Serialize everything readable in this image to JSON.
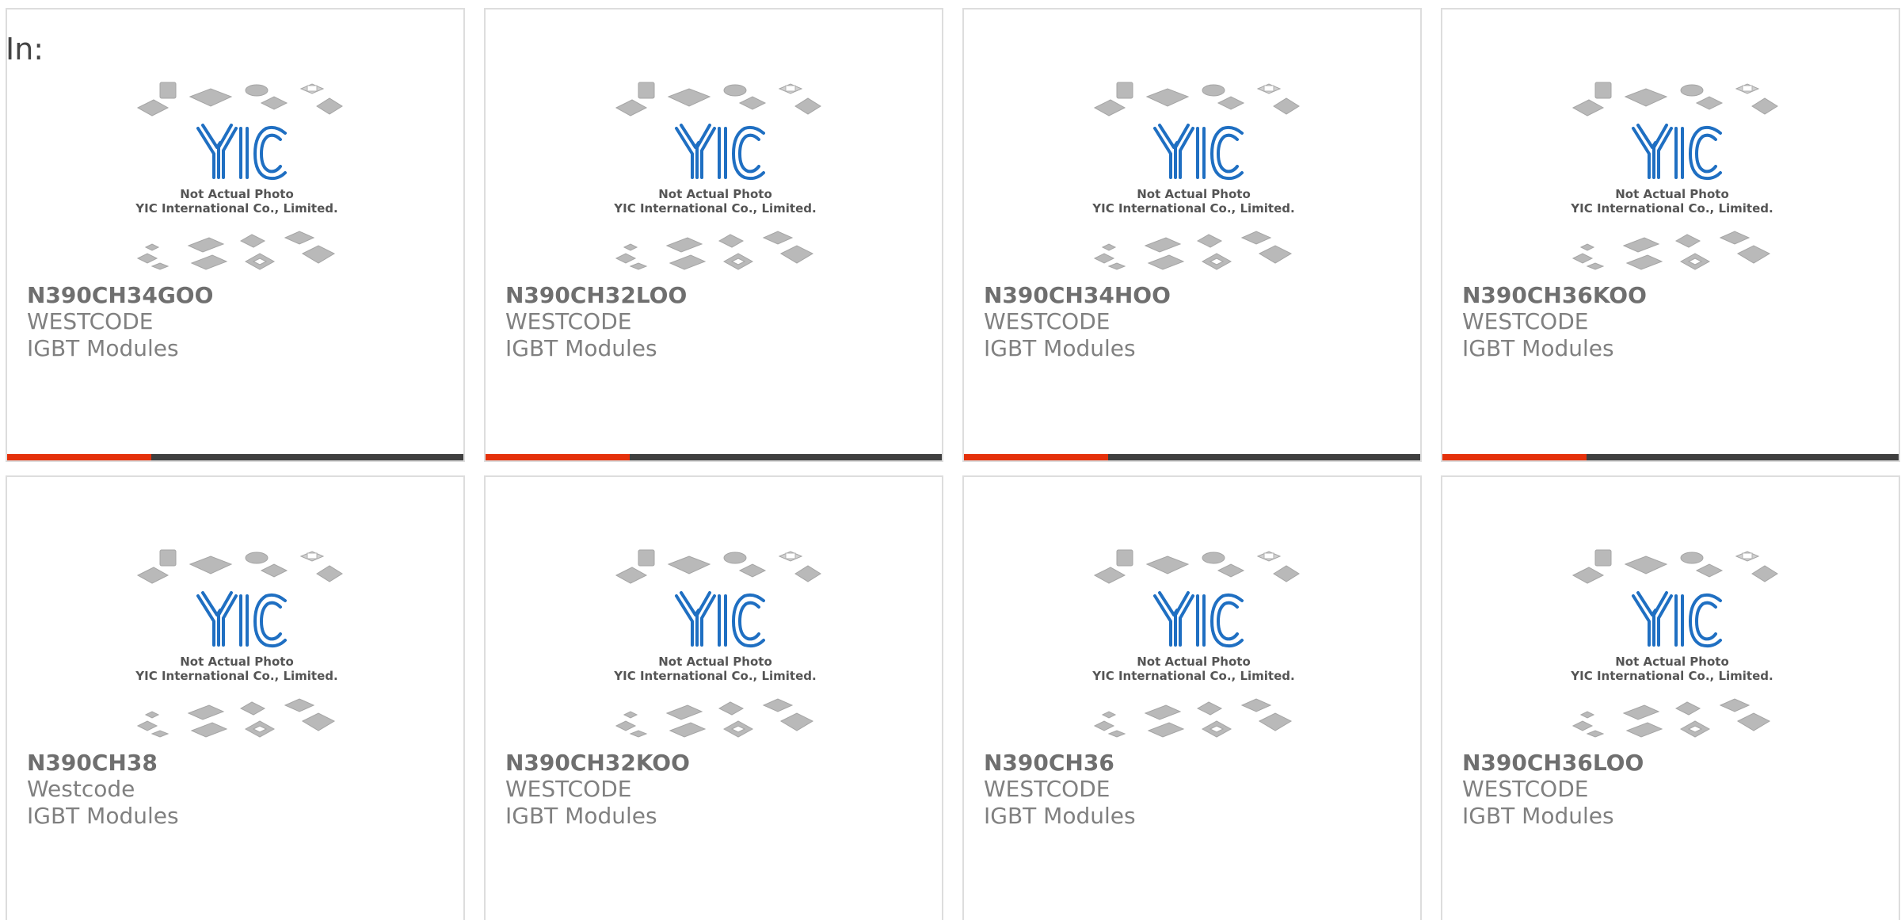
{
  "page": {
    "heading": "In:"
  },
  "colors": {
    "accent_bar": "#e5310b",
    "dark_bar": "#3f3f3f",
    "logo_blue": "#1f6fc2",
    "chip_gray": "#b4b4b4"
  },
  "photo": {
    "line1": "Not Actual Photo",
    "line2": "YIC International Co., Limited.",
    "logo_text": "YIC"
  },
  "products": [
    {
      "part_number": "N390CH34GOO",
      "manufacturer": "WESTCODE",
      "category": "IGBT Modules"
    },
    {
      "part_number": "N390CH32LOO",
      "manufacturer": "WESTCODE",
      "category": "IGBT Modules"
    },
    {
      "part_number": "N390CH34HOO",
      "manufacturer": "WESTCODE",
      "category": "IGBT Modules"
    },
    {
      "part_number": "N390CH36KOO",
      "manufacturer": "WESTCODE",
      "category": "IGBT Modules"
    },
    {
      "part_number": "N390CH38",
      "manufacturer": "Westcode",
      "category": "IGBT Modules"
    },
    {
      "part_number": "N390CH32KOO",
      "manufacturer": "WESTCODE",
      "category": "IGBT Modules"
    },
    {
      "part_number": "N390CH36",
      "manufacturer": "WESTCODE",
      "category": "IGBT Modules"
    },
    {
      "part_number": "N390CH36LOO",
      "manufacturer": "WESTCODE",
      "category": "IGBT Modules"
    }
  ]
}
